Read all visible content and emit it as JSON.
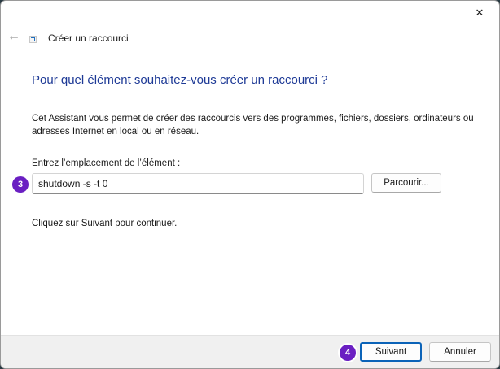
{
  "window": {
    "title": "Créer un raccourci",
    "close_glyph": "✕",
    "back_glyph": "←"
  },
  "main": {
    "heading": "Pour quel élément souhaitez-vous créer un raccourci ?",
    "description": "Cet Assistant vous permet de créer des raccourcis vers des programmes, fichiers, dossiers, ordinateurs ou adresses Internet en local ou en réseau.",
    "field_label": "Entrez l’emplacement de l’élément :",
    "location_value": "shutdown -s -t 0",
    "browse_label": "Parcourir...",
    "continue_text": "Cliquez sur Suivant pour continuer."
  },
  "footer": {
    "next_label": "Suivant",
    "cancel_label": "Annuler"
  },
  "annotations": {
    "step_3": "3",
    "step_4": "4"
  },
  "colors": {
    "heading": "#1e3a96",
    "badge": "#6a1fc2",
    "primary_border": "#0b63b8"
  },
  "icons": {
    "back": "back-arrow-icon",
    "close": "close-icon",
    "app": "shortcut-icon"
  }
}
